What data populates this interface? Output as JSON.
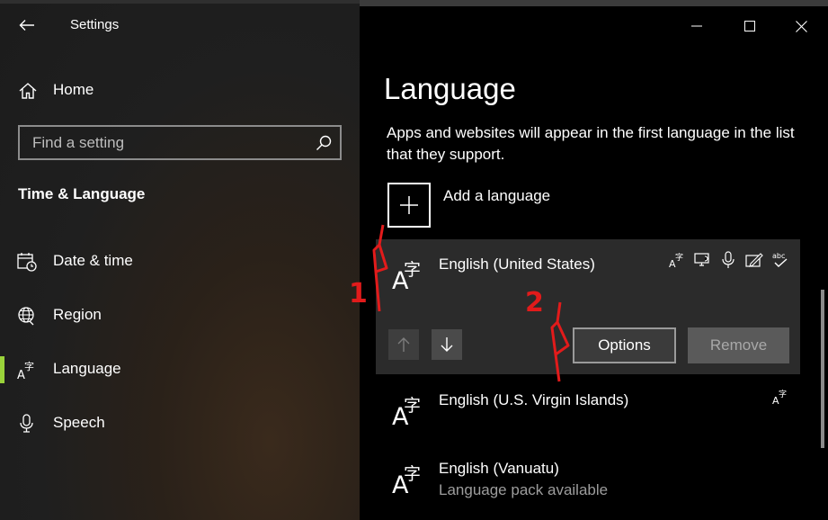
{
  "window": {
    "title": "Settings"
  },
  "sidebar": {
    "home_label": "Home",
    "search_placeholder": "Find a setting",
    "section_title": "Time & Language",
    "items": [
      {
        "label": "Date & time",
        "icon": "calendar-clock-icon"
      },
      {
        "label": "Region",
        "icon": "globe-icon"
      },
      {
        "label": "Language",
        "icon": "language-icon",
        "active": true
      },
      {
        "label": "Speech",
        "icon": "microphone-icon"
      }
    ]
  },
  "main": {
    "title": "Language",
    "description": "Apps and websites will appear in the first language in the list that they support.",
    "add_language_label": "Add a language",
    "languages": [
      {
        "name": "English (United States)",
        "features": [
          "display-language-icon",
          "text-to-speech-icon",
          "speech-recognition-icon",
          "handwriting-icon",
          "spell-check-icon"
        ],
        "options_label": "Options",
        "remove_label": "Remove"
      },
      {
        "name": "English (U.S. Virgin Islands)",
        "features": [
          "display-language-icon"
        ]
      },
      {
        "name": "English (Vanuatu)",
        "status": "Language pack available"
      }
    ]
  },
  "annotations": {
    "step1": "1",
    "step2": "2"
  },
  "colors": {
    "accent": "#9ad33a",
    "annotation": "#e21b1b"
  }
}
